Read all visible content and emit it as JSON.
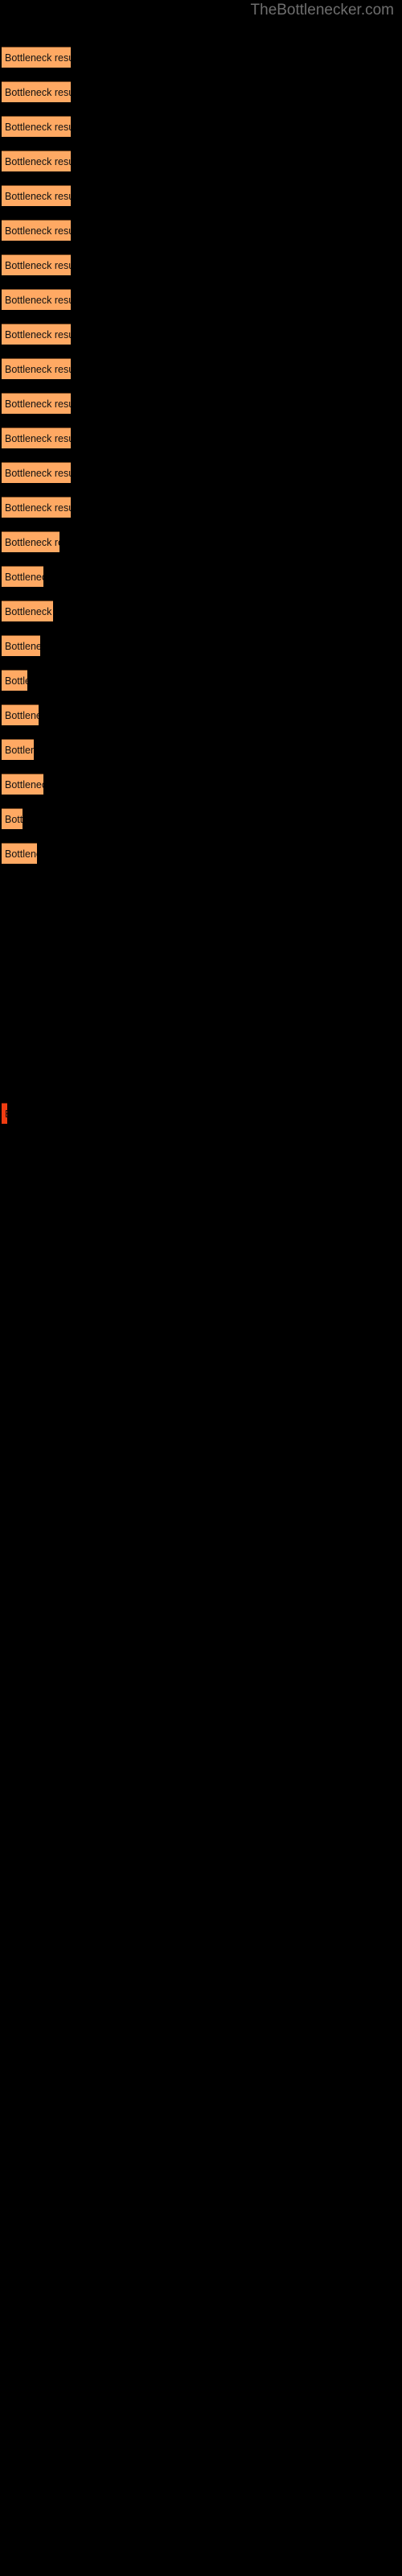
{
  "watermark": {
    "text": "TheBottlenecker.com"
  },
  "colors": {
    "background": "#000000",
    "bar_fill": "#ffa963",
    "bar_edge": "#7a4a22",
    "bar_fill_highlight": "#f03c11",
    "label_text": "#111111",
    "watermark_text": "#6e6e6e"
  },
  "chart_data": {
    "type": "bar",
    "orientation": "horizontal",
    "title": "",
    "subtitle": "",
    "xlabel": "",
    "ylabel": "",
    "grid": false,
    "legend": null,
    "xlim": [
      0,
      100
    ],
    "bar_label_text": "Bottleneck result",
    "categories": [
      "",
      "",
      "",
      "",
      "",
      "",
      "",
      "",
      "",
      "",
      "",
      "",
      "",
      "",
      "",
      "",
      "",
      "",
      "",
      "",
      "",
      "",
      "",
      "",
      ""
    ],
    "values": [
      86,
      86,
      86,
      86,
      86,
      86,
      86,
      86,
      86,
      86,
      86,
      86,
      86,
      86,
      72,
      52,
      64,
      48,
      32,
      46,
      40,
      52,
      26,
      44,
      2
    ],
    "bars": [
      {
        "y": 58,
        "width": 86,
        "label": "Bottleneck result",
        "color": "bar_fill"
      },
      {
        "y": 101,
        "width": 86,
        "label": "Bottleneck result",
        "color": "bar_fill"
      },
      {
        "y": 144,
        "width": 86,
        "label": "Bottleneck result",
        "color": "bar_fill"
      },
      {
        "y": 187,
        "width": 86,
        "label": "Bottleneck result",
        "color": "bar_fill"
      },
      {
        "y": 230,
        "width": 86,
        "label": "Bottleneck result",
        "color": "bar_fill"
      },
      {
        "y": 273,
        "width": 86,
        "label": "Bottleneck result",
        "color": "bar_fill"
      },
      {
        "y": 316,
        "width": 86,
        "label": "Bottleneck result",
        "color": "bar_fill"
      },
      {
        "y": 359,
        "width": 86,
        "label": "Bottleneck result",
        "color": "bar_fill"
      },
      {
        "y": 402,
        "width": 86,
        "label": "Bottleneck result",
        "color": "bar_fill"
      },
      {
        "y": 445,
        "width": 86,
        "label": "Bottleneck result",
        "color": "bar_fill"
      },
      {
        "y": 488,
        "width": 86,
        "label": "Bottleneck result",
        "color": "bar_fill"
      },
      {
        "y": 531,
        "width": 86,
        "label": "Bottleneck result",
        "color": "bar_fill"
      },
      {
        "y": 574,
        "width": 86,
        "label": "Bottleneck result",
        "color": "bar_fill"
      },
      {
        "y": 617,
        "width": 86,
        "label": "Bottleneck result",
        "color": "bar_fill"
      },
      {
        "y": 660,
        "width": 72,
        "label": "Bottleneck result",
        "color": "bar_fill"
      },
      {
        "y": 703,
        "width": 52,
        "label": "Bottleneck result",
        "color": "bar_fill"
      },
      {
        "y": 746,
        "width": 64,
        "label": "Bottleneck result",
        "color": "bar_fill"
      },
      {
        "y": 789,
        "width": 48,
        "label": "Bottleneck result",
        "color": "bar_fill"
      },
      {
        "y": 832,
        "width": 32,
        "label": "Bottleneck result",
        "color": "bar_fill"
      },
      {
        "y": 875,
        "width": 46,
        "label": "Bottleneck result",
        "color": "bar_fill"
      },
      {
        "y": 918,
        "width": 40,
        "label": "Bottleneck result",
        "color": "bar_fill"
      },
      {
        "y": 961,
        "width": 52,
        "label": "Bottleneck result",
        "color": "bar_fill"
      },
      {
        "y": 1004,
        "width": 26,
        "label": "Bottleneck result",
        "color": "bar_fill"
      },
      {
        "y": 1047,
        "width": 44,
        "label": "Bottleneck result",
        "color": "bar_fill"
      },
      {
        "y": 1370,
        "width": 7,
        "label": "Bottleneck result",
        "color": "bar_fill_highlight"
      }
    ]
  }
}
